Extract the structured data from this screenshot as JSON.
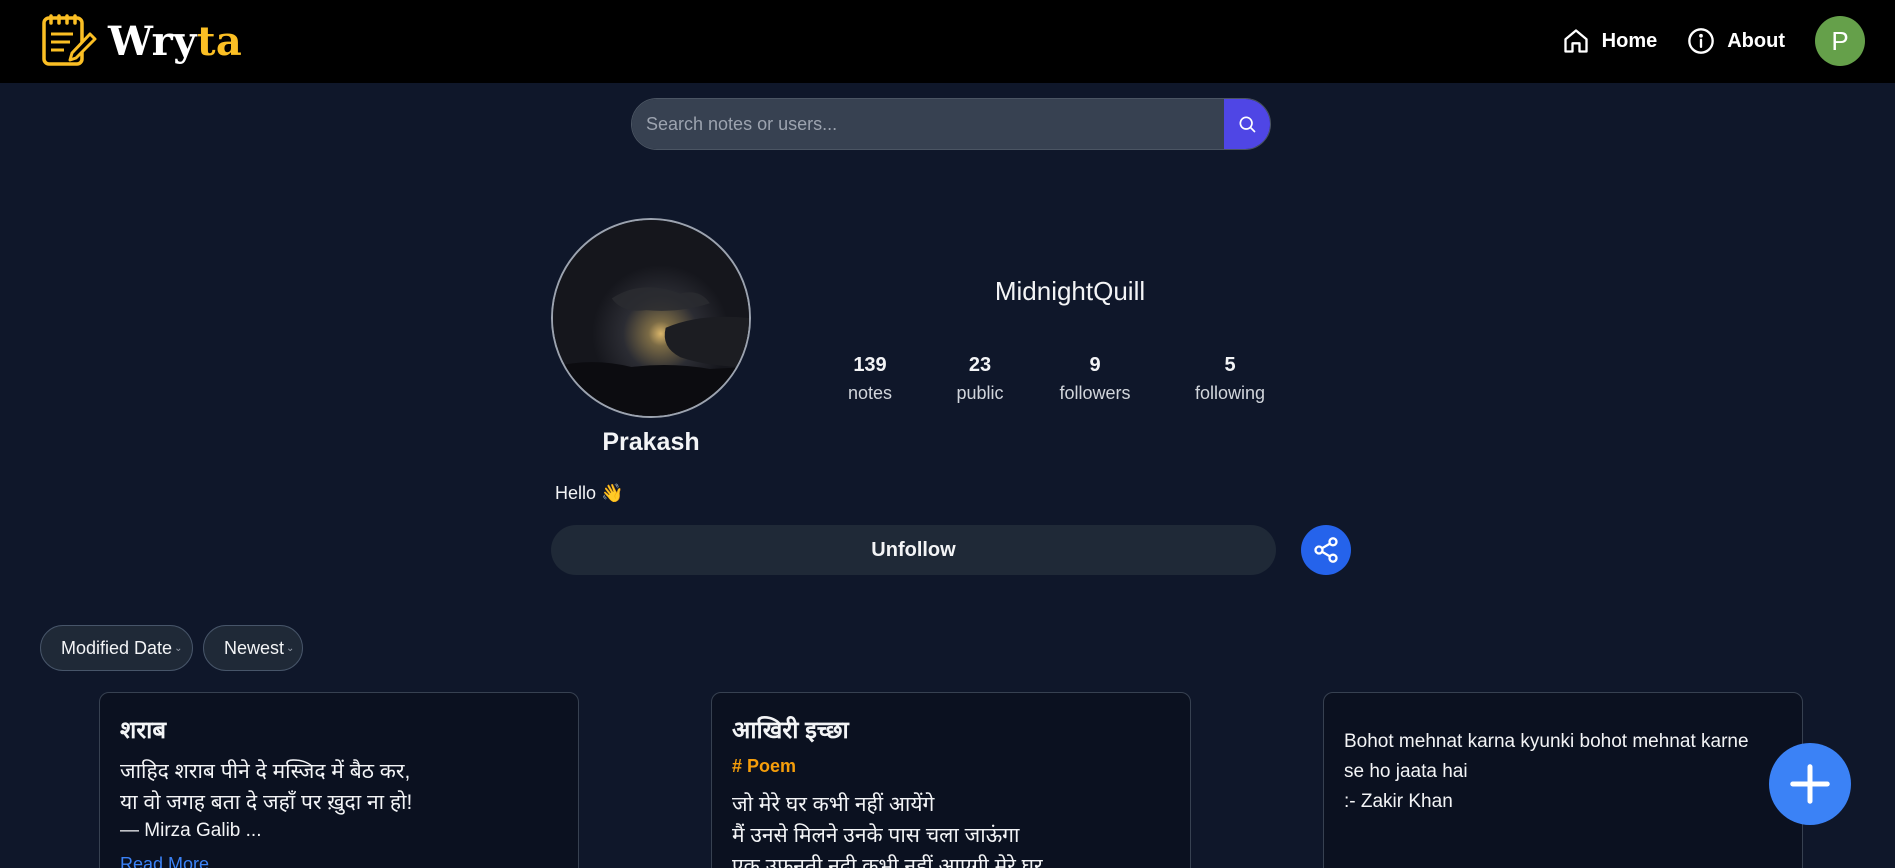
{
  "brand": {
    "name_main": "Wry",
    "name_accent": "ta",
    "accent_color": "#fbbf24"
  },
  "nav": {
    "home_label": "Home",
    "about_label": "About",
    "avatar_initial": "P",
    "avatar_color": "#65a04a"
  },
  "search": {
    "placeholder": "Search notes or users..."
  },
  "profile": {
    "display_name": "Prakash",
    "username": "MidnightQuill",
    "bio": "Hello 👋",
    "stats": [
      {
        "value": "139",
        "label": "notes"
      },
      {
        "value": "23",
        "label": "public"
      },
      {
        "value": "9",
        "label": "followers"
      },
      {
        "value": "5",
        "label": "following"
      }
    ],
    "unfollow_label": "Unfollow"
  },
  "filters": {
    "sort_field": "Modified Date",
    "sort_order": "Newest"
  },
  "notes": [
    {
      "title": "शराब",
      "tag": "",
      "lines": [
        "जाहिद शराब पीने दे मस्जिद में बैठ कर,",
        "या वो जगह बता दे जहाँ पर ख़ुदा ना हो!"
      ],
      "signature": "— Mirza Galib ...",
      "read_more": "Read More"
    },
    {
      "title": "आखिरी इच्छा",
      "tag": "# Poem",
      "lines": [
        "जो मेरे घर कभी नहीं आयेंगे",
        "मैं उनसे मिलने उनके पास चला जाऊंगा",
        "एक उफनती नदी कभी नहीं आएगी मेरे घर"
      ],
      "signature": "",
      "read_more": ""
    },
    {
      "title": "",
      "tag": "",
      "lines": [
        "Bohot mehnat karna kyunki bohot mehnat karne",
        "se ho jaata hai",
        ":- Zakir Khan"
      ],
      "signature": "",
      "read_more": ""
    }
  ],
  "accent": {
    "primary_blue": "#3b82f6",
    "search_button": "#4f46e5",
    "tag_color": "#f59e0b"
  }
}
